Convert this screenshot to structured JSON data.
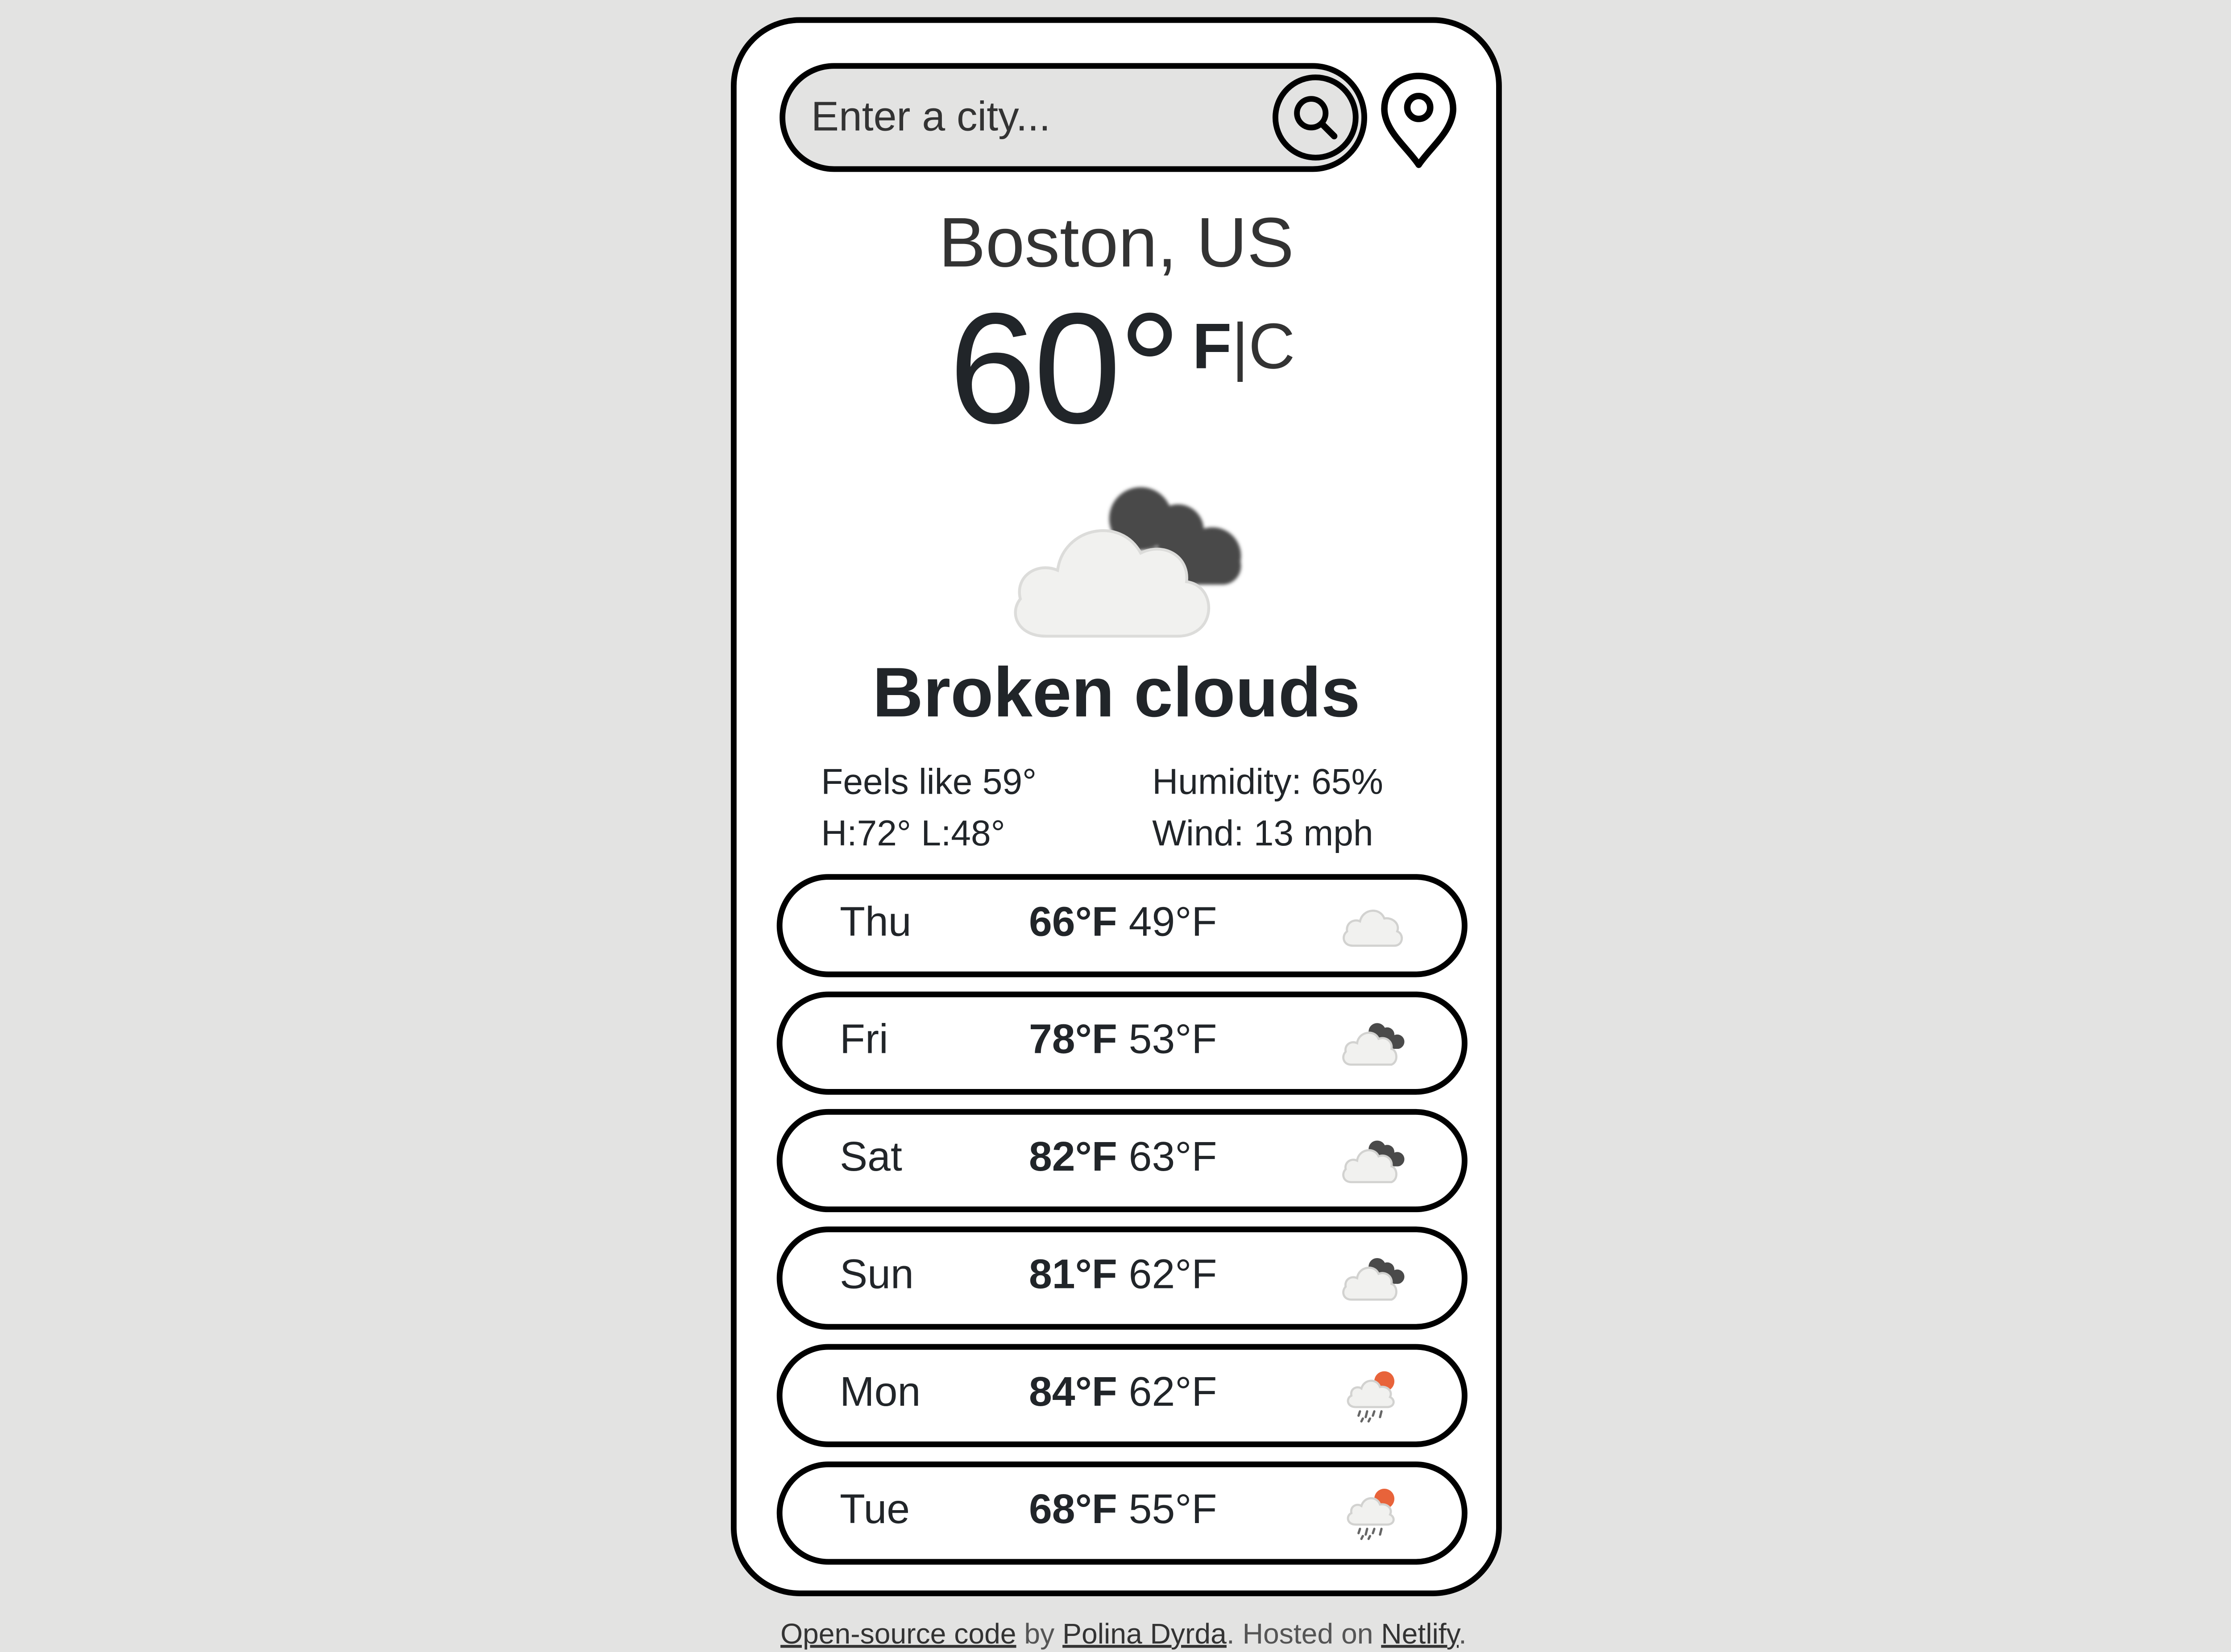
{
  "search": {
    "placeholder": "Enter a city..."
  },
  "current": {
    "city": "Boston, US",
    "temperature": "60°",
    "unit_f": "F",
    "unit_separator": "|",
    "unit_c": "C",
    "icon": "broken-clouds-icon",
    "description": "Broken clouds",
    "feels_like": "Feels like 59°",
    "high_low": "H:72° L:48°",
    "humidity": "Humidity: 65%",
    "wind": "Wind: 13 mph"
  },
  "forecast": [
    {
      "day": "Thu",
      "high": "66°F",
      "low": "49°F",
      "icon": "cloud-icon"
    },
    {
      "day": "Fri",
      "high": "78°F",
      "low": "53°F",
      "icon": "broken-clouds-icon"
    },
    {
      "day": "Sat",
      "high": "82°F",
      "low": "63°F",
      "icon": "broken-clouds-icon"
    },
    {
      "day": "Sun",
      "high": "81°F",
      "low": "62°F",
      "icon": "broken-clouds-icon"
    },
    {
      "day": "Mon",
      "high": "84°F",
      "low": "62°F",
      "icon": "sun-rain-icon"
    },
    {
      "day": "Tue",
      "high": "68°F",
      "low": "55°F",
      "icon": "sun-rain-icon"
    }
  ],
  "footer": {
    "source_link": "Open-source code",
    "by_text": " by ",
    "author_link": "Polina Dyrda",
    "hosted_text": ". Hosted on ",
    "host_link": "Netlify",
    "end_text": "."
  },
  "colors": {
    "background": "#e3e3e2",
    "card": "#ffffff",
    "border": "#000000",
    "text": "#212529",
    "sun_accent": "#e8633a"
  }
}
